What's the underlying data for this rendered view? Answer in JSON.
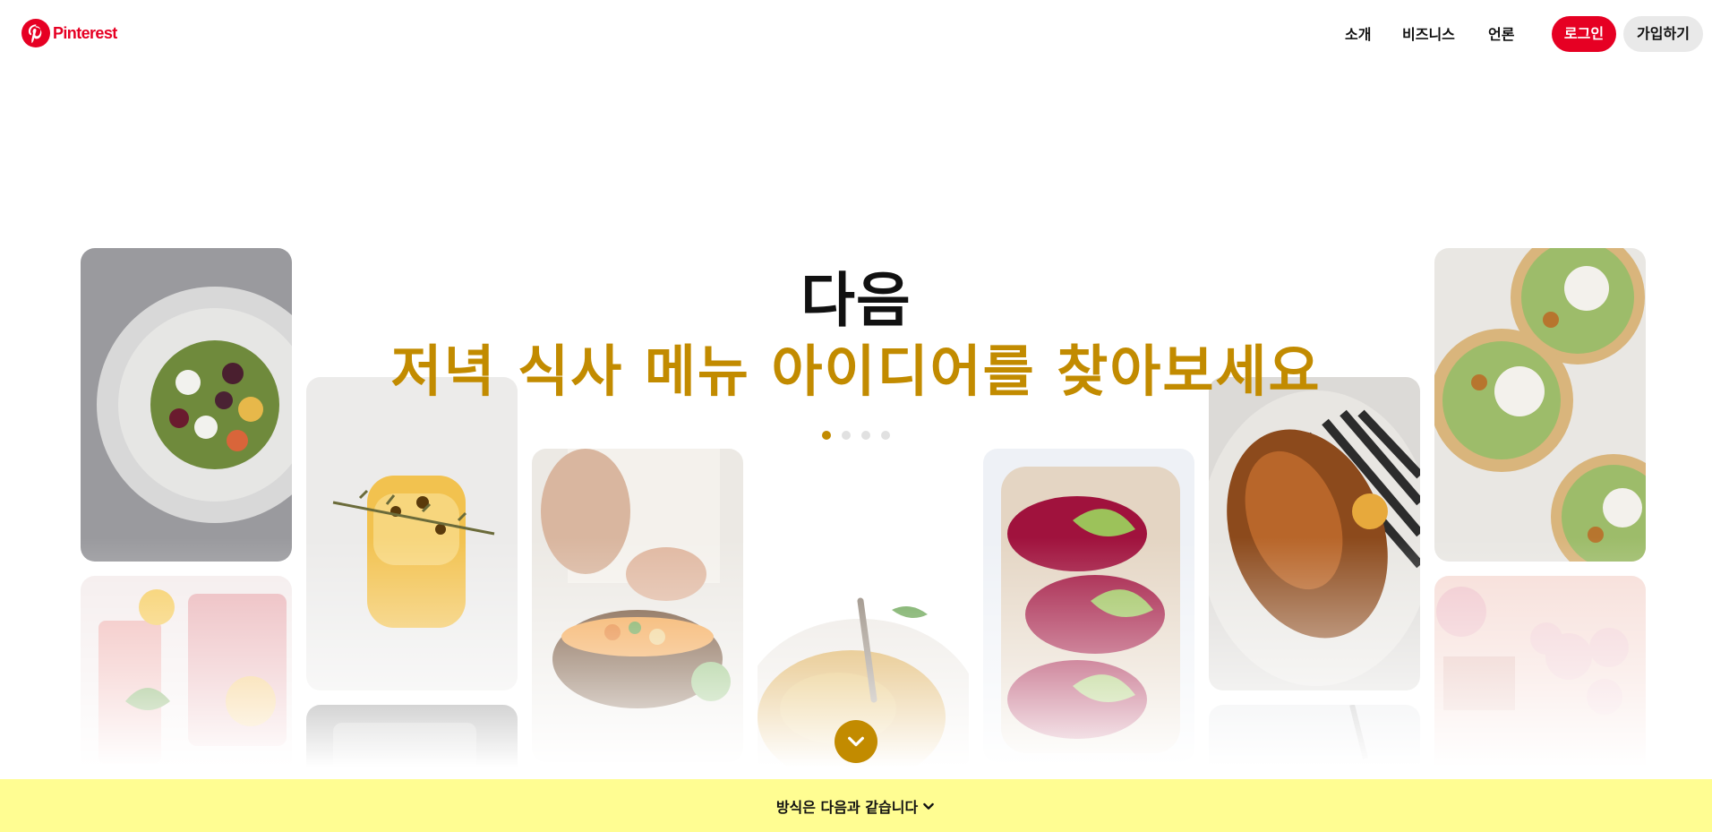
{
  "header": {
    "logo_text": "Pinterest",
    "nav": [
      "소개",
      "비즈니스",
      "언론"
    ],
    "login_label": "로그인",
    "signup_label": "가입하기"
  },
  "hero": {
    "line1": "다음",
    "line2": "저녁 식사 메뉴 아이디어를 찾아보세요",
    "accent_color": "#c28b00",
    "carousel_dots": 4,
    "active_dot": 0
  },
  "pins": [
    {
      "subject": "beet-salad"
    },
    {
      "subject": "pink-lemonade"
    },
    {
      "subject": "turmeric-drink"
    },
    {
      "subject": "dark-dish"
    },
    {
      "subject": "vegetable-bowl"
    },
    {
      "subject": "hummus-bowl"
    },
    {
      "subject": "beet-avocado-toast"
    },
    {
      "subject": "roast-chicken"
    },
    {
      "subject": "partial-plate"
    },
    {
      "subject": "chickpea-flatbread"
    },
    {
      "subject": "pink-room-balloons"
    }
  ],
  "bottom_bar": {
    "label": "방식은 다음과 같습니다",
    "color": "#fffd92"
  },
  "colors": {
    "brand_red": "#e60023",
    "signup_bg": "#e9e9e9"
  }
}
